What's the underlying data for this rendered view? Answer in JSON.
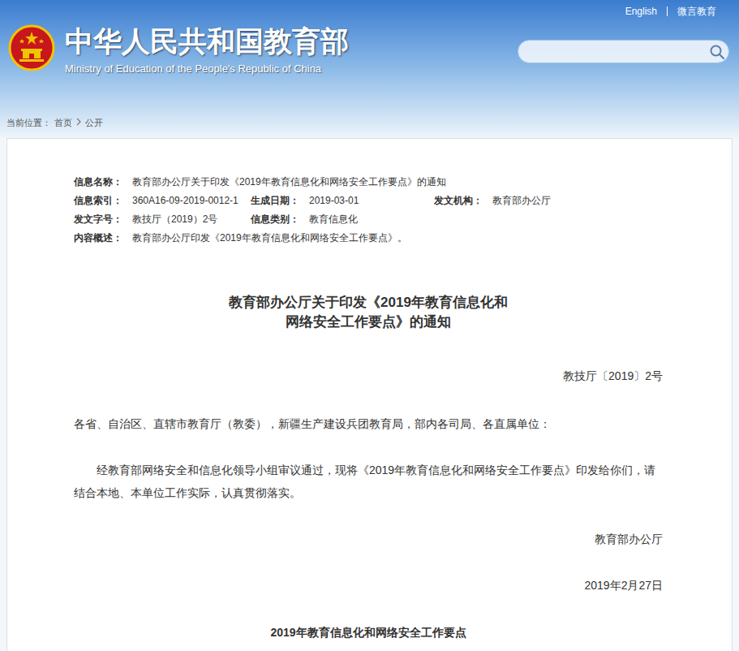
{
  "header": {
    "title": "中华人民共和国教育部",
    "subtitle": "Ministry of Education of the People's Republic of China",
    "links": [
      "English",
      "微言教育"
    ]
  },
  "breadcrumb": {
    "label": "当前位置：",
    "items": [
      "首页",
      "公开"
    ]
  },
  "meta": [
    [
      {
        "label": "信息名称：",
        "value": "教育部办公厅关于印发《2019年教育信息化和网络安全工作要点》的通知"
      }
    ],
    [
      {
        "label": "信息索引：",
        "value": "360A16-09-2019-0012-1"
      },
      {
        "label": "生成日期：",
        "value": "2019-03-01"
      },
      {
        "label": "发文机构：",
        "value": "教育部办公厅"
      }
    ],
    [
      {
        "label": "发文字号：",
        "value": "教技厅（2019）2号"
      },
      {
        "label": "信息类别：",
        "value": "教育信息化"
      }
    ],
    [
      {
        "label": "内容概述：",
        "value": "教育部办公厅印发《2019年教育信息化和网络安全工作要点》。"
      }
    ]
  ],
  "document": {
    "title_lines": [
      "教育部办公厅关于印发《2019年教育信息化和",
      "网络安全工作要点》的通知"
    ],
    "number": "教技厅〔2019〕2号",
    "addressee": "各省、自治区、直辖市教育厅（教委），新疆生产建设兵团教育局，部内各司局、各直属单位：",
    "body": "经教育部网络安全和信息化领导小组审议通过，现将《2019年教育信息化和网络安全工作要点》印发给你们，请结合本地、本单位工作实际，认真贯彻落实。",
    "signature": "教育部办公厅",
    "date": "2019年2月27日",
    "attachment_title": "2019年教育信息化和网络安全工作要点"
  }
}
